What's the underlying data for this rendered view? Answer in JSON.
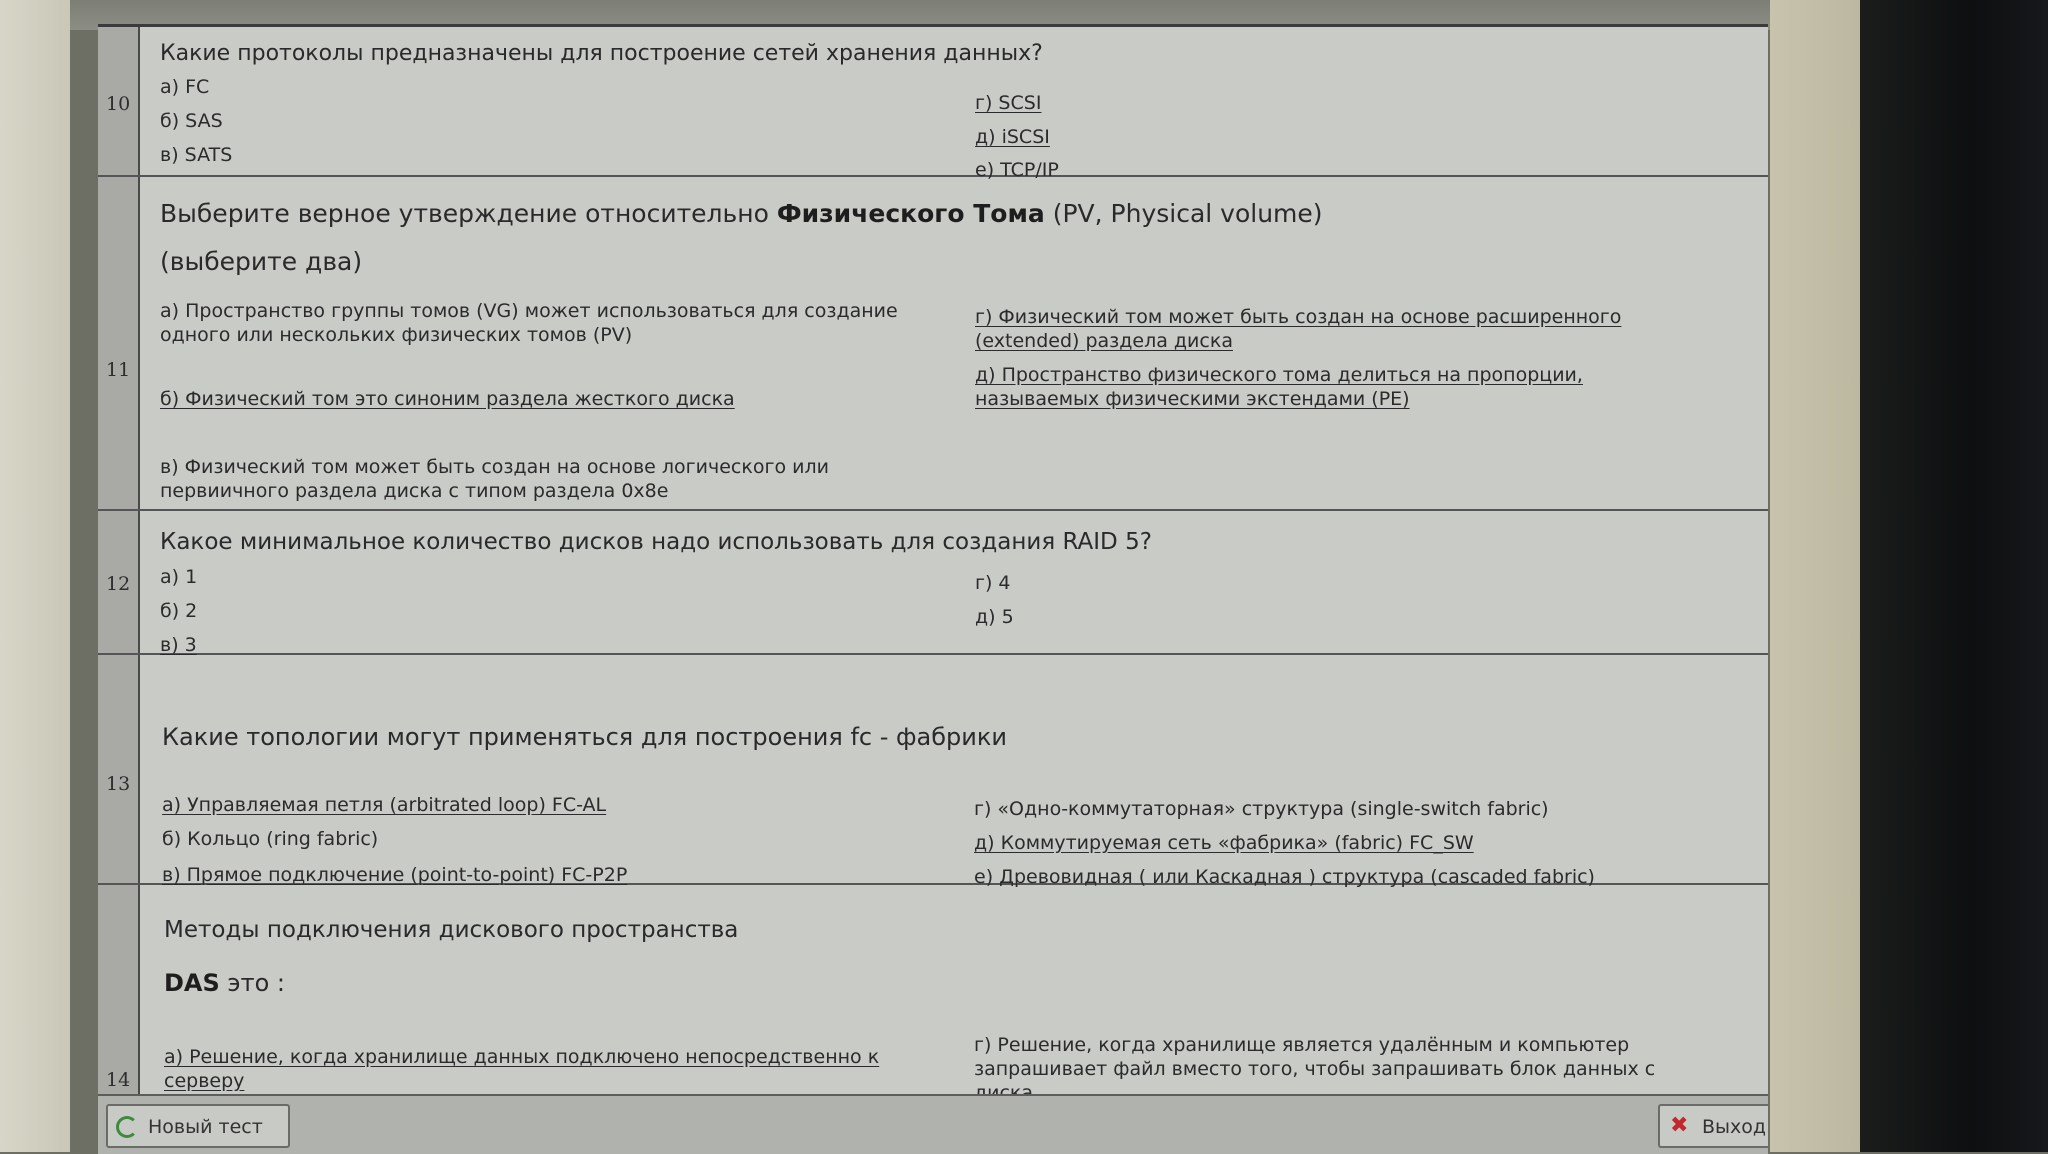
{
  "questions": [
    {
      "number": "10",
      "text": "Какие протоколы предназначены для построение сетей хранения данных?",
      "options_left": [
        {
          "text": "а) FC"
        },
        {
          "text": "б) SAS"
        },
        {
          "text": "в) SATS"
        }
      ],
      "options_right": [
        {
          "text": "г) SCSI"
        },
        {
          "text": "д) iSCSI"
        },
        {
          "text": "е) TCP/IP"
        }
      ]
    },
    {
      "number": "11",
      "text_before": "Выберите верное утверждение относительно ",
      "text_bold": "Физического Тома",
      "text_after": " (PV, Physical volume)",
      "hint": "(выберите два)",
      "options_left": [
        {
          "text": "а) Пространство группы томов (VG) может использоваться для создание одного или нескольких физических томов (PV)"
        },
        {
          "text": "б) Физический том это синоним раздела жесткого диска"
        },
        {
          "text": "в) Физический том может быть создан на основе логического или первиичного раздела диска с типом раздела 0x8e"
        }
      ],
      "options_right": [
        {
          "text": "г) Физический том может быть создан на основе расширенного (extended) раздела диска"
        },
        {
          "text": "д) Пространство физического тома делиться на пропорции, называемых физическими экстендами (PE)"
        }
      ]
    },
    {
      "number": "12",
      "text": "Какое минимальное количество дисков надо использовать для создания RAID 5?",
      "options_left": [
        {
          "text": "а) 1"
        },
        {
          "text": "б) 2"
        },
        {
          "text": "в) 3"
        }
      ],
      "options_right": [
        {
          "text": "г) 4"
        },
        {
          "text": "д) 5"
        }
      ]
    },
    {
      "number": "13",
      "text": "Какие топологии могут применяться для построения fc - фабрики",
      "options_left": [
        {
          "text": "а) Управляемая петля (arbitrated loop) FC-AL"
        },
        {
          "text": "б) Кольцо (ring fabric)"
        },
        {
          "text": "в) Прямое подключение (point-to-point) FC-P2P"
        }
      ],
      "options_right": [
        {
          "text": "г) «Одно-коммутаторная» структура (single-switch fabric)"
        },
        {
          "text": "д) Коммутируемая сеть  «фабрика» (fabric) FC_SW"
        },
        {
          "text": "е) Древовидная ( или Каскадная ) структура (cascaded fabric)"
        }
      ]
    },
    {
      "number": "14",
      "text": "Методы подключения дискового пространства",
      "subtitle_bold": "DAS",
      "subtitle_rest": " это :",
      "options_left": [
        {
          "text": "а) Решение, когда хранилище данных подключено непосредственно к серверу"
        }
      ],
      "options_right": [
        {
          "text": "г) Решение, когда хранилище является удалённым и компьютер запрашивает файл вместо того, чтобы запрашивать блок данных с диска."
        }
      ]
    }
  ],
  "footer": {
    "new_test_label": "Новый тест",
    "exit_label": "Выход"
  },
  "icons": {
    "new_test": "refresh-icon",
    "exit": "exit-icon"
  }
}
